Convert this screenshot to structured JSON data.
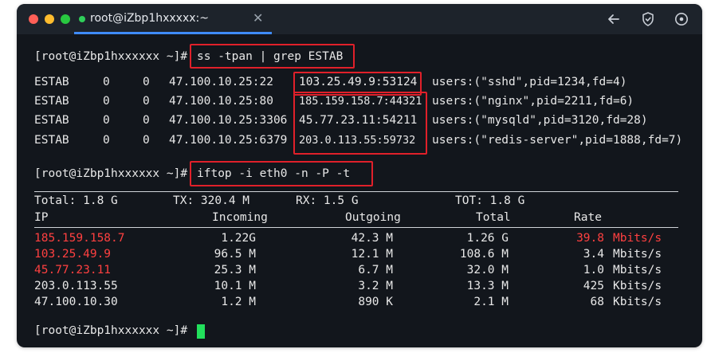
{
  "window": {
    "tab_title": "root@iZbp1hxxxxx:~",
    "tab_close": "✕",
    "icons": [
      "back-arrow-icon",
      "shield-icon",
      "settings-icon"
    ]
  },
  "terminal": {
    "prompt": "[root@iZbp1hxxxxxx ~]#",
    "cmd1": "ss -tpan | grep ESTAB",
    "ss_rows": [
      {
        "state": "ESTAB",
        "recvq": "0",
        "sendq": "0",
        "local": "47.100.10.25:22",
        "peer": "103.25.49.9:53124",
        "process": "users:(\"sshd\",pid=1234,fd=4)"
      },
      {
        "state": "ESTAB",
        "recvq": "0",
        "sendq": "0",
        "local": "47.100.10.25:80",
        "peer": "185.159.158.7:44321",
        "process": "users:(\"nginx\",pid=2211,fd=6)"
      },
      {
        "state": "ESTAB",
        "recvq": "0",
        "sendq": "0",
        "local": "47.100.10.25:3306",
        "peer": "45.77.23.11:54211",
        "process": "users:(\"mysqld\",pid=3120,fd=28)"
      },
      {
        "state": "ESTAB",
        "recvq": "0",
        "sendq": "0",
        "local": "47.100.10.25:6379",
        "peer": "203.0.113.55:59732",
        "process": "users:(\"redis-server\",pid=1888,fd=7)"
      }
    ],
    "cmd2": "iftop -i eth0 -n -P -t",
    "summary": {
      "total": "Total: 1.8 G",
      "tx": "TX: 320.4 M",
      "rx": "RX: 1.5 G",
      "tot": "TOT: 1.8 G"
    },
    "headers": {
      "ip": "IP",
      "incoming": "Incoming",
      "outgoing": "Outgoing",
      "total": "Total",
      "rate": "Rate"
    },
    "iftop_rows": [
      {
        "ip": "185.159.158.7",
        "incoming": "1.22G",
        "outgoing": "42.3 M",
        "total": "1.26 G",
        "rate": "39.8",
        "unit": "Mbits/s"
      },
      {
        "ip": "103.25.49.9",
        "incoming": "96.5 M",
        "outgoing": "12.1 M",
        "total": "108.6 M",
        "rate": "3.4",
        "unit": "Mbits/s"
      },
      {
        "ip": "45.77.23.11",
        "incoming": "25.3 M",
        "outgoing": "6.7 M",
        "total": "32.0 M",
        "rate": "1.0",
        "unit": "Mbits/s"
      },
      {
        "ip": "203.0.113.55",
        "incoming": "10.1 M",
        "outgoing": "3.2 M",
        "total": "13.3 M",
        "rate": "425",
        "unit": "Kbits/s"
      },
      {
        "ip": "47.100.10.30",
        "incoming": "1.2 M",
        "outgoing": "890 K",
        "total": "2.1 M",
        "rate": "68",
        "unit": "Kbits/s"
      }
    ],
    "colors": {
      "highlight": "#e0202a",
      "alert_text": "#ff4040",
      "cursor": "#22e05c"
    }
  }
}
